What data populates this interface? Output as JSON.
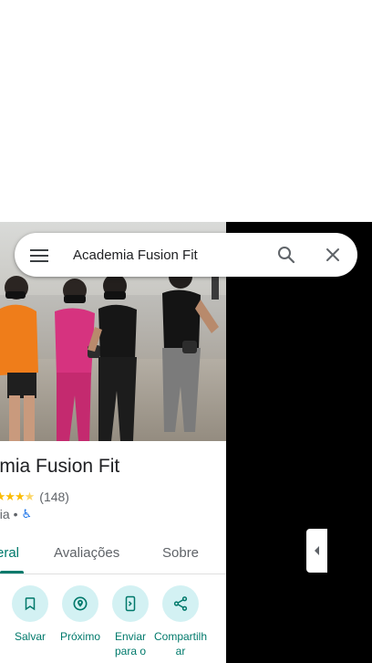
{
  "search": {
    "value": "Academia Fusion Fit"
  },
  "place": {
    "name": "Academia Fusion Fit",
    "name_visible": "demia Fusion Fit",
    "rating_count": "(148)",
    "rating_value": 4.5,
    "category_visible": "nia •"
  },
  "tabs": [
    {
      "label": "eral",
      "active": true
    },
    {
      "label": "Avaliações",
      "active": false
    },
    {
      "label": "Sobre",
      "active": false
    }
  ],
  "actions": [
    {
      "label": "Salvar",
      "icon": "bookmark-icon"
    },
    {
      "label": "Próximo",
      "icon": "nearby-icon"
    },
    {
      "label": "Enviar para o",
      "icon": "send-to-phone-icon"
    },
    {
      "label": "Compartilhar",
      "icon": "share-icon"
    }
  ],
  "colors": {
    "accent": "#00796b",
    "action_bg": "#d3f1f3",
    "star": "#fbbc04",
    "map_bg": "#000000"
  }
}
